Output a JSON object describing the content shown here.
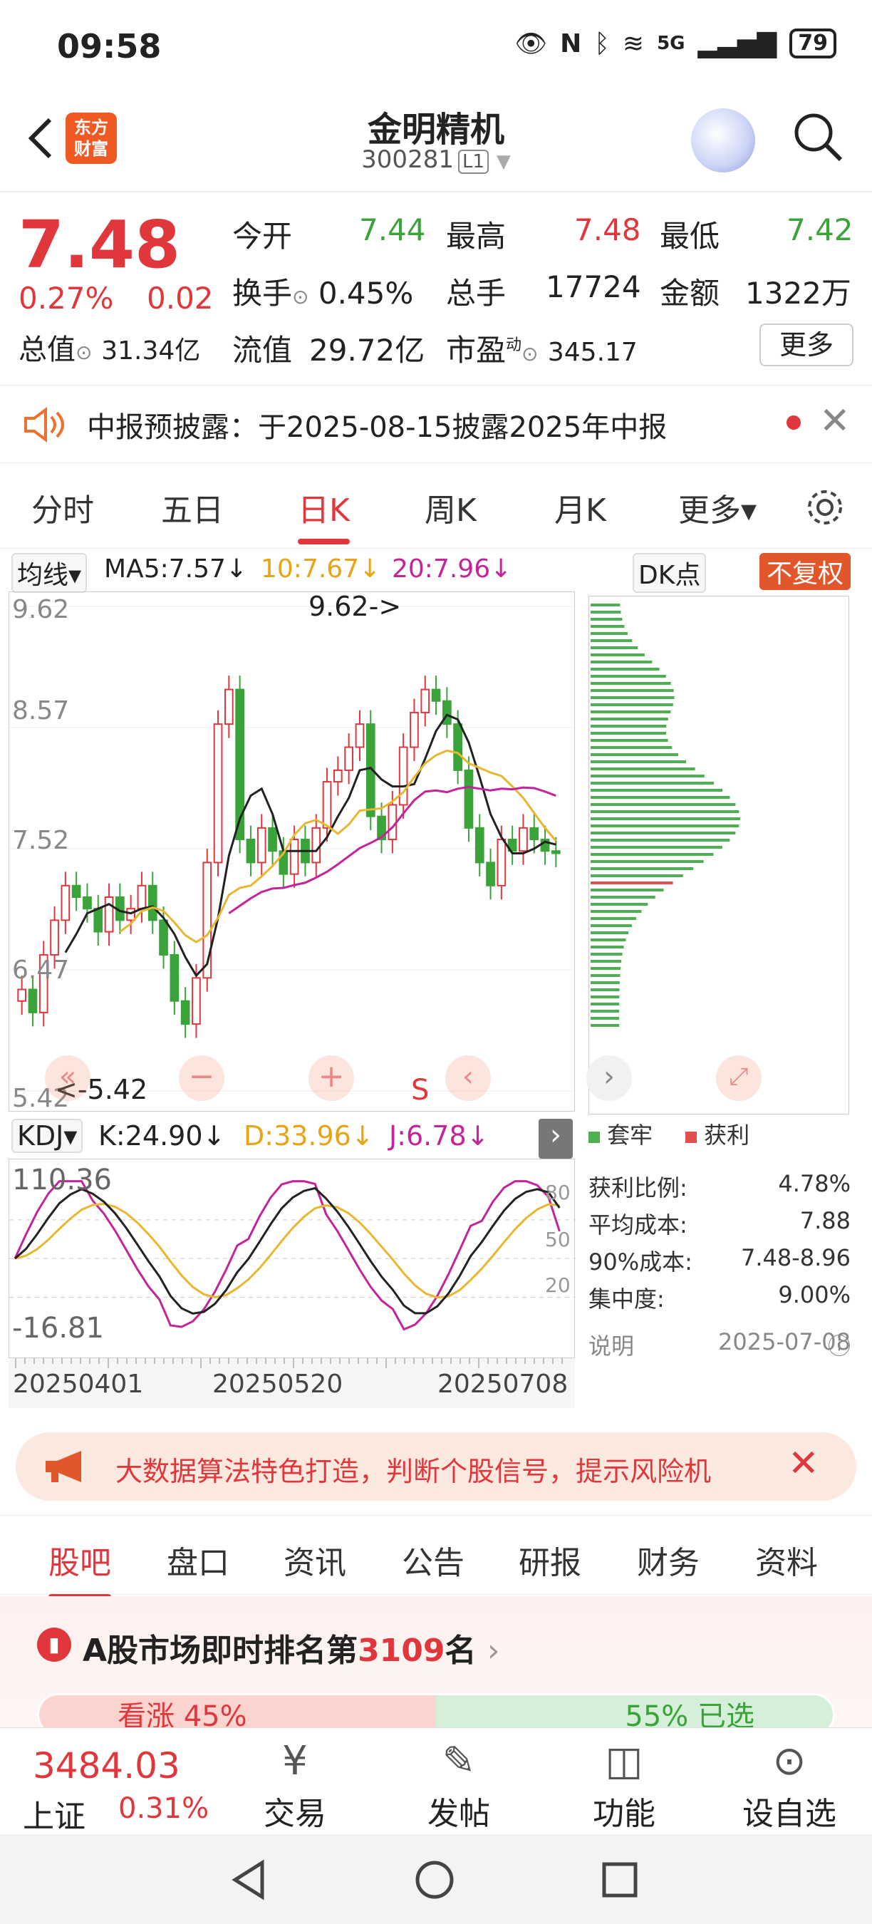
{
  "status": {
    "time": "09:58",
    "network": "5G",
    "battery": "79"
  },
  "header": {
    "back": "<",
    "logo": "东方\n财富",
    "name": "金明精机",
    "code": "300281",
    "board": "L1"
  },
  "quote": {
    "price": "7.48",
    "pct": "0.27%",
    "chg": "0.02",
    "open_label": "今开",
    "open": "7.44",
    "high_label": "最高",
    "high": "7.48",
    "low_label": "最低",
    "low": "7.42",
    "turnover_label": "换手",
    "turnover": "0.45%",
    "volume_label": "总手",
    "volume": "17724",
    "amount_label": "金额",
    "amount": "1322万",
    "mktcap_label": "总值",
    "mktcap": "31.34亿",
    "float_label": "流值",
    "float": "29.72亿",
    "pe_label": "市盈",
    "pe_sup": "动",
    "pe": "345.17",
    "more": "更多"
  },
  "notice": {
    "text": "中报预披露：于2025-08-15披露2025年中报"
  },
  "tabs": [
    "分时",
    "五日",
    "日K",
    "周K",
    "月K",
    "更多▾"
  ],
  "ma": {
    "selector": "均线▾",
    "ma5": "MA5:7.57↓",
    "ma10": "10:7.67↓",
    "ma20": "20:7.96↓",
    "dk": "DK点",
    "fq": "不复权"
  },
  "chart_labels": {
    "y1": "9.62",
    "y2": "8.57",
    "y3": "7.52",
    "y4": "6.47",
    "y5": "5.42",
    "high_mark": "9.62->",
    "low_mark": "<-5.42",
    "s": "S"
  },
  "kdj": {
    "selector": "KDJ▾",
    "k": "K:24.90↓",
    "d": "D:33.96↓",
    "j": "J:6.78↓",
    "top": "110.36",
    "bottom": "-16.81",
    "r80": "80",
    "r50": "50",
    "r20": "20"
  },
  "dates": [
    "20250401",
    "20250520",
    "20250708"
  ],
  "chip": {
    "legend_trap": "套牢",
    "legend_profit": "获利",
    "rows": [
      [
        "获利比例:",
        "4.78%"
      ],
      [
        "平均成本:",
        "7.88"
      ],
      [
        "90%成本:",
        "7.48-8.96"
      ],
      [
        "集中度:",
        "9.00%"
      ]
    ],
    "note": "说明",
    "date": "2025-07-08"
  },
  "banner": {
    "text": "大数据算法特色打造，判断个股信号，提示风险机"
  },
  "subtabs": [
    "股吧",
    "盘口",
    "资讯",
    "公告",
    "研报",
    "财务",
    "资料"
  ],
  "rank": {
    "title_a": "A股市场即时排名第",
    "rank": "3109",
    "title_b": "名",
    "up": "看涨 45%",
    "down": "55% 已选"
  },
  "bottom": {
    "index_value": "3484.03",
    "index_name": "上证",
    "index_pct": "0.31%",
    "nav": [
      "交易",
      "发帖",
      "功能",
      "设自选"
    ]
  },
  "chart_data": {
    "type": "candlestick",
    "ylim": [
      5.42,
      9.62
    ],
    "yticks": [
      "9.62",
      "8.57",
      "7.52",
      "6.47",
      "5.42"
    ],
    "xticks": [
      "20250401",
      "20250520",
      "20250708"
    ],
    "high": 9.62,
    "low": 5.42,
    "series": [
      {
        "name": "MA5",
        "last": 7.57
      },
      {
        "name": "10",
        "last": 7.67
      },
      {
        "name": "20",
        "last": 7.96
      }
    ],
    "close": [
      6.3,
      6.1,
      6.6,
      6.9,
      7.2,
      7.1,
      7.0,
      6.8,
      7.1,
      6.9,
      7.0,
      7.2,
      6.9,
      6.6,
      6.2,
      6.0,
      6.4,
      7.4,
      8.6,
      8.9,
      7.6,
      7.4,
      7.7,
      7.5,
      7.3,
      7.6,
      7.4,
      7.7,
      8.1,
      8.2,
      8.4,
      8.6,
      7.8,
      7.6,
      7.9,
      8.4,
      8.7,
      8.9,
      8.8,
      8.6,
      8.2,
      7.7,
      7.4,
      7.2,
      7.6,
      7.5,
      7.7,
      7.6,
      7.5,
      7.48
    ]
  },
  "kdj_data": {
    "K": 24.9,
    "D": 33.96,
    "J": 6.78,
    "range": [
      -16.81,
      110.36
    ]
  }
}
